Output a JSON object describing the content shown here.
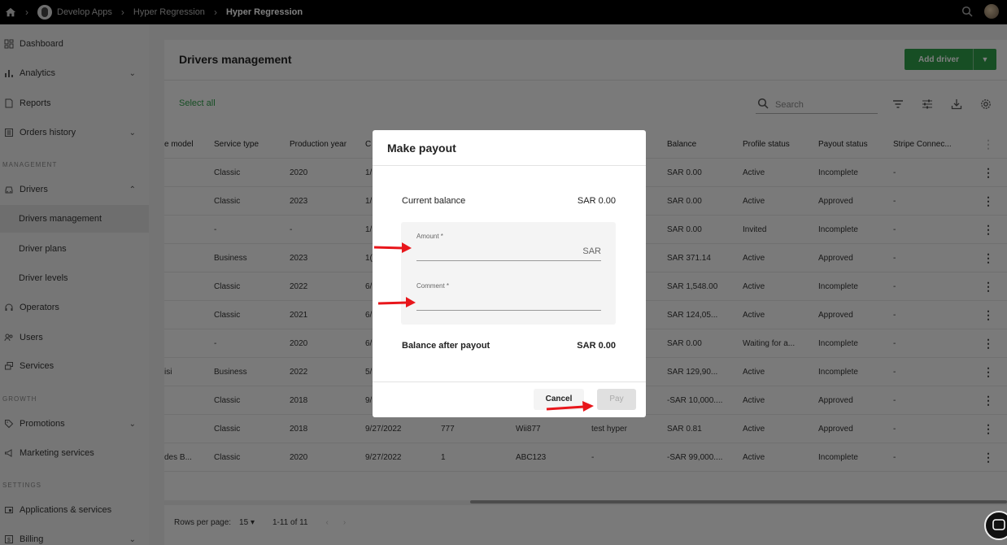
{
  "topbar": {
    "crumbs": [
      "Develop Apps",
      "Hyper Regression",
      "Hyper Regression"
    ]
  },
  "sidebar": {
    "items": [
      {
        "label": "Dashboard",
        "icon": "dashboard-icon"
      },
      {
        "label": "Analytics",
        "icon": "analytics-icon"
      },
      {
        "label": "Reports",
        "icon": "reports-icon"
      },
      {
        "label": "Orders history",
        "icon": "orders-icon"
      },
      {
        "label": "Drivers",
        "icon": "car-icon"
      },
      {
        "label": "Drivers management"
      },
      {
        "label": "Driver plans"
      },
      {
        "label": "Driver levels"
      },
      {
        "label": "Operators",
        "icon": "headset-icon"
      },
      {
        "label": "Users",
        "icon": "users-icon"
      },
      {
        "label": "Services",
        "icon": "services-icon"
      },
      {
        "label": "Promotions",
        "icon": "tag-icon"
      },
      {
        "label": "Marketing services",
        "icon": "megaphone-icon"
      },
      {
        "label": "Applications & services",
        "icon": "apps-icon"
      },
      {
        "label": "Billing",
        "icon": "billing-icon"
      }
    ],
    "sections": [
      "MANAGEMENT",
      "GROWTH",
      "SETTINGS"
    ]
  },
  "page": {
    "title": "Drivers management",
    "add_driver": "Add driver",
    "select_all": "Select all",
    "search_placeholder": "Search"
  },
  "table": {
    "columns": [
      "e model",
      "Service type",
      "Production year",
      "C",
      "",
      "",
      "",
      "Balance",
      "Profile status",
      "Payout status",
      "Stripe Connec..."
    ],
    "rows": [
      [
        "",
        "Classic",
        "2020",
        "1/",
        "",
        "",
        "",
        "SAR 0.00",
        "Active",
        "Incomplete",
        "-"
      ],
      [
        "",
        "Classic",
        "2023",
        "1/",
        "",
        "",
        "",
        "SAR 0.00",
        "Active",
        "Approved",
        "-"
      ],
      [
        "",
        "-",
        "-",
        "1/",
        "",
        "",
        "",
        "SAR 0.00",
        "Invited",
        "Incomplete",
        "-"
      ],
      [
        "",
        "Business",
        "2023",
        "1(",
        "",
        "",
        "",
        "SAR 371.14",
        "Active",
        "Approved",
        "-"
      ],
      [
        "",
        "Classic",
        "2022",
        "6/",
        "",
        "",
        "",
        "SAR 1,548.00",
        "Active",
        "Incomplete",
        "-"
      ],
      [
        "",
        "Classic",
        "2021",
        "6/",
        "",
        "",
        "",
        "SAR 124,05...",
        "Active",
        "Approved",
        "-"
      ],
      [
        "",
        "-",
        "2020",
        "6/",
        "",
        "",
        "",
        "SAR 0.00",
        "Waiting for a...",
        "Incomplete",
        "-"
      ],
      [
        "isi",
        "Business",
        "2022",
        "5/",
        "",
        "",
        "",
        "SAR 129,90...",
        "Active",
        "Incomplete",
        "-"
      ],
      [
        "",
        "Classic",
        "2018",
        "9/",
        "",
        "",
        "",
        "-SAR 10,000....",
        "Active",
        "Approved",
        "-"
      ],
      [
        "",
        "Classic",
        "2018",
        "9/27/2022",
        "777",
        "Wii877",
        "test hyper",
        "SAR 0.81",
        "Active",
        "Approved",
        "-"
      ],
      [
        "des B...",
        "Classic",
        "2020",
        "9/27/2022",
        "1",
        "ABC123",
        "-",
        "-SAR 99,000....",
        "Active",
        "Incomplete",
        "-"
      ]
    ]
  },
  "footer": {
    "rows_per_page_label": "Rows per page:",
    "rows_per_page_value": "15",
    "range": "1-11 of 11"
  },
  "modal": {
    "title": "Make payout",
    "current_balance_label": "Current balance",
    "current_balance_value": "SAR 0.00",
    "amount_label": "Amount *",
    "amount_suffix": "SAR",
    "comment_label": "Comment *",
    "after_label": "Balance after payout",
    "after_value": "SAR 0.00",
    "cancel": "Cancel",
    "pay": "Pay"
  },
  "colors": {
    "accent": "#2e9c49",
    "annotation_arrow": "#e8161b"
  }
}
